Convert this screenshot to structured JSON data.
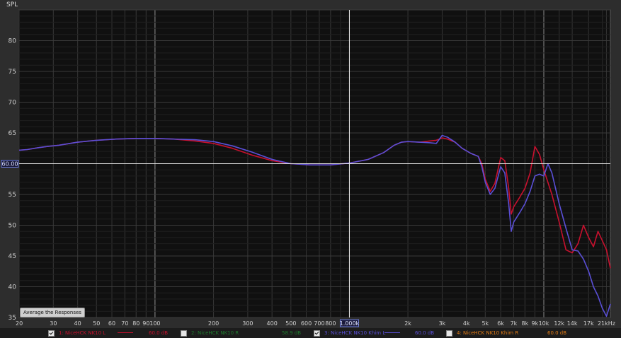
{
  "chart_data": {
    "type": "line",
    "ylabel": "SPL",
    "y_range": [
      35,
      85
    ],
    "y_ticks": [
      35,
      40,
      45,
      50,
      55,
      60,
      65,
      70,
      75,
      80
    ],
    "x_scale": "log",
    "x_range": [
      20,
      22000
    ],
    "x_ticks": [
      {
        "v": 20,
        "label": "20"
      },
      {
        "v": 30,
        "label": "30"
      },
      {
        "v": 40,
        "label": "40"
      },
      {
        "v": 50,
        "label": "50"
      },
      {
        "v": 60,
        "label": "60"
      },
      {
        "v": 70,
        "label": "70"
      },
      {
        "v": 80,
        "label": "80"
      },
      {
        "v": 90,
        "label": "90"
      },
      {
        "v": 100,
        "label": "100"
      },
      {
        "v": 200,
        "label": "200"
      },
      {
        "v": 300,
        "label": "300"
      },
      {
        "v": 400,
        "label": "400"
      },
      {
        "v": 500,
        "label": "500"
      },
      {
        "v": 600,
        "label": "600"
      },
      {
        "v": 700,
        "label": "700"
      },
      {
        "v": 800,
        "label": "800"
      },
      {
        "v": 1000,
        "label": "1.000k"
      },
      {
        "v": 2000,
        "label": "2k"
      },
      {
        "v": 3000,
        "label": "3k"
      },
      {
        "v": 4000,
        "label": "4k"
      },
      {
        "v": 5000,
        "label": "5k"
      },
      {
        "v": 6000,
        "label": "6k"
      },
      {
        "v": 7000,
        "label": "7k"
      },
      {
        "v": 8000,
        "label": "8k"
      },
      {
        "v": 9000,
        "label": "9k"
      },
      {
        "v": 10000,
        "label": "10k"
      },
      {
        "v": 12000,
        "label": "12k"
      },
      {
        "v": 14000,
        "label": "14k"
      },
      {
        "v": 17000,
        "label": "17k"
      },
      {
        "v": 21000,
        "label": "21kHz"
      }
    ],
    "cursor": {
      "x": 1000,
      "y": 60.0,
      "y_label": "60.00",
      "x_label": "1.000k"
    },
    "grid": true,
    "series": [
      {
        "name": "1: NiceHCK NK10 L",
        "color": "#c8102e",
        "x": [
          20,
          22,
          25,
          28,
          32,
          40,
          50,
          63,
          80,
          100,
          125,
          160,
          200,
          250,
          315,
          400,
          500,
          630,
          800,
          1000,
          1250,
          1500,
          1700,
          1850,
          2000,
          2300,
          2600,
          2800,
          3000,
          3200,
          3500,
          3800,
          4200,
          4600,
          4800,
          5000,
          5300,
          5600,
          6000,
          6300,
          6600,
          6800,
          7000,
          7500,
          8000,
          8500,
          9000,
          9500,
          10000,
          11000,
          12000,
          13000,
          14000,
          15000,
          16000,
          17000,
          18000,
          19000,
          20000,
          21000,
          22000
        ],
        "y": [
          62.2,
          62.3,
          62.6,
          62.8,
          63.0,
          63.5,
          63.8,
          64.0,
          64.1,
          64.1,
          64.0,
          63.7,
          63.3,
          62.5,
          61.4,
          60.5,
          60.0,
          59.8,
          59.8,
          60.1,
          60.7,
          61.8,
          63.0,
          63.5,
          63.6,
          63.5,
          63.7,
          63.8,
          64.2,
          64.0,
          63.5,
          62.5,
          61.7,
          61.2,
          60.0,
          57.5,
          55.5,
          56.8,
          61.0,
          60.5,
          56.0,
          51.8,
          53.0,
          54.5,
          56.0,
          58.5,
          62.8,
          61.5,
          59.0,
          55.0,
          50.5,
          46.0,
          45.5,
          47.0,
          50.0,
          48.0,
          46.5,
          49.0,
          47.5,
          46.0,
          43.0
        ]
      },
      {
        "name": "2: NiceHCK NK10 R",
        "color": "#1f7a2e",
        "x": [],
        "y": []
      },
      {
        "name": "3: NiceHCK NK10 Khim L",
        "color": "#5a4fd6",
        "x": [
          20,
          22,
          25,
          28,
          32,
          40,
          50,
          63,
          80,
          100,
          125,
          160,
          200,
          250,
          315,
          400,
          500,
          630,
          800,
          1000,
          1250,
          1500,
          1700,
          1850,
          2000,
          2300,
          2600,
          2800,
          3000,
          3200,
          3500,
          3800,
          4200,
          4600,
          4800,
          5000,
          5300,
          5600,
          6000,
          6300,
          6600,
          6800,
          7000,
          7500,
          8000,
          8500,
          9000,
          9500,
          10000,
          10500,
          11000,
          12000,
          13000,
          14000,
          15000,
          16000,
          17000,
          18000,
          19000,
          20000,
          21000,
          22000
        ],
        "y": [
          62.2,
          62.3,
          62.6,
          62.8,
          63.0,
          63.5,
          63.8,
          64.0,
          64.1,
          64.1,
          64.0,
          63.9,
          63.6,
          62.9,
          61.9,
          60.7,
          60.0,
          59.8,
          59.8,
          60.1,
          60.7,
          61.8,
          63.0,
          63.5,
          63.6,
          63.5,
          63.4,
          63.3,
          64.6,
          64.3,
          63.5,
          62.5,
          61.7,
          61.2,
          59.5,
          57.0,
          55.0,
          56.0,
          59.5,
          58.5,
          53.5,
          49.0,
          50.5,
          52.0,
          53.5,
          55.5,
          58.0,
          58.3,
          58.0,
          60.0,
          58.5,
          53.5,
          49.5,
          46.0,
          45.8,
          44.5,
          42.5,
          40.0,
          38.5,
          36.5,
          35.2,
          37.2
        ]
      },
      {
        "name": "4: NiceHCK NK10 Khim R",
        "color": "#e07b16",
        "x": [],
        "y": []
      }
    ]
  },
  "controls": {
    "average_button": "Average the Responses"
  },
  "legend": [
    {
      "label": "1: NiceHCK NK10 L",
      "checked": true,
      "value": "60.0 dB",
      "color": "#c8102e"
    },
    {
      "label": "2: NiceHCK NK10 R",
      "checked": false,
      "value": "58.9 dB",
      "color": "#1f7a2e"
    },
    {
      "label": "3: NiceHCK NK10 Khim L",
      "checked": true,
      "value": "60.0 dB",
      "color": "#5a4fd6"
    },
    {
      "label": "4: NiceHCK NK10 Khim R",
      "checked": false,
      "value": "60.0 dB",
      "color": "#e07b16"
    }
  ]
}
